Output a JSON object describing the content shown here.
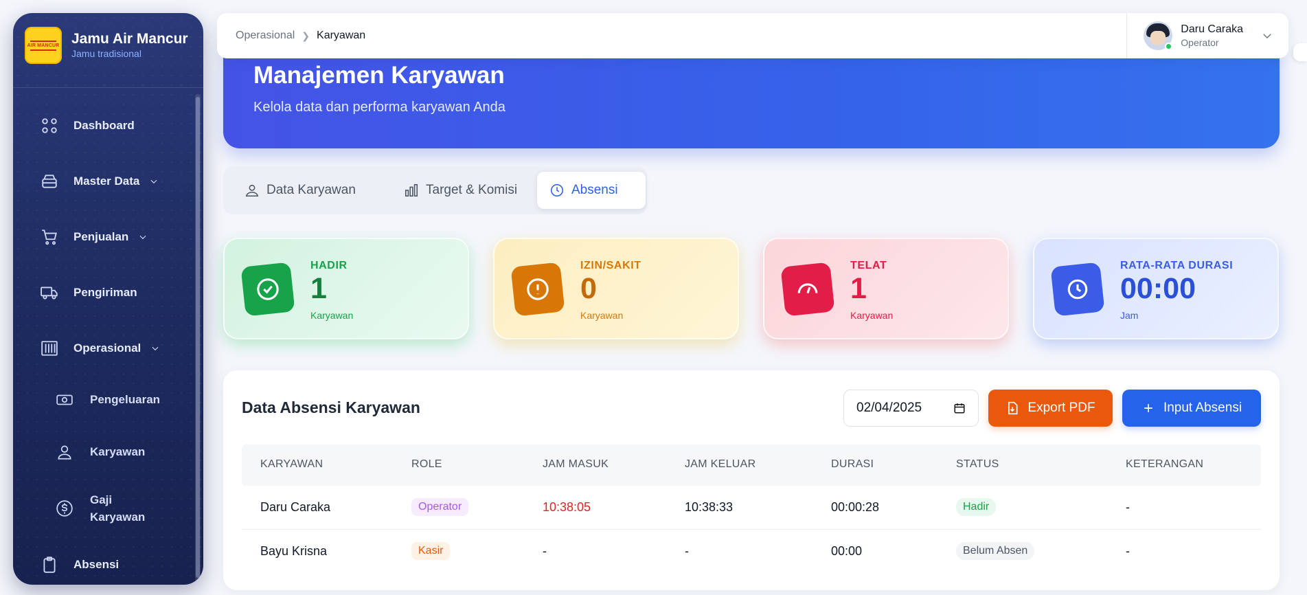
{
  "brand": {
    "name": "Jamu Air Mancur",
    "tagline": "Jamu tradisional",
    "logo_text": "AIR MANCUR"
  },
  "sidebar": {
    "items": [
      {
        "label": "Dashboard",
        "icon": "grid-icon",
        "has_children": false
      },
      {
        "label": "Master Data",
        "icon": "database-icon",
        "has_children": true
      },
      {
        "label": "Penjualan",
        "icon": "cart-icon",
        "has_children": true
      },
      {
        "label": "Pengiriman",
        "icon": "truck-icon",
        "has_children": false
      },
      {
        "label": "Operasional",
        "icon": "barcode-icon",
        "has_children": true,
        "expanded": true
      },
      {
        "label": "Absensi",
        "icon": "clipboard-icon",
        "has_children": false
      }
    ],
    "subitems": [
      {
        "label": "Pengeluaran",
        "icon": "cash-icon"
      },
      {
        "label": "Karyawan",
        "icon": "user-icon"
      },
      {
        "label": "Gaji Karyawan",
        "line1": "Gaji",
        "line2": "Karyawan",
        "icon": "dollar-icon"
      }
    ]
  },
  "topbar": {
    "breadcrumb": [
      "Operasional",
      "Karyawan"
    ],
    "user": {
      "name": "Daru Caraka",
      "role": "Operator",
      "online": true
    }
  },
  "hero": {
    "title": "Manajemen Karyawan",
    "subtitle": "Kelola data dan performa karyawan Anda"
  },
  "tabs": [
    {
      "label": "Data Karyawan",
      "icon": "users-icon",
      "active": false
    },
    {
      "label": "Target & Komisi",
      "icon": "bar-chart-icon",
      "active": false
    },
    {
      "label": "Absensi",
      "icon": "clock-icon",
      "active": true
    }
  ],
  "stats": [
    {
      "label": "HADIR",
      "value": "1",
      "unit": "Karyawan",
      "icon": "check-circle-icon",
      "color": "#16a34a"
    },
    {
      "label": "IZIN/SAKIT",
      "value": "0",
      "unit": "Karyawan",
      "icon": "alert-circle-icon",
      "color": "#d97706"
    },
    {
      "label": "TELAT",
      "value": "1",
      "unit": "Karyawan",
      "icon": "gauge-icon",
      "color": "#e11d48"
    },
    {
      "label": "RATA-RATA DURASI",
      "value": "00:00",
      "unit": "Jam",
      "icon": "clock-icon",
      "color": "#3b5ce6"
    }
  ],
  "attendance": {
    "title": "Data Absensi Karyawan",
    "date_value": "02/04/2025",
    "export_label": "Export PDF",
    "add_label": "Input Absensi",
    "columns": [
      "KARYAWAN",
      "ROLE",
      "JAM MASUK",
      "JAM KELUAR",
      "DURASI",
      "STATUS",
      "KETERANGAN"
    ],
    "rows": [
      {
        "name": "Daru Caraka",
        "role": "Operator",
        "jam_masuk": "10:38:05",
        "jam_keluar": "10:38:33",
        "durasi": "00:00:28",
        "status": "Hadir",
        "keterangan": "-"
      },
      {
        "name": "Bayu Krisna",
        "role": "Kasir",
        "jam_masuk": "-",
        "jam_keluar": "-",
        "durasi": "00:00",
        "status": "Belum Absen",
        "keterangan": "-"
      }
    ]
  }
}
